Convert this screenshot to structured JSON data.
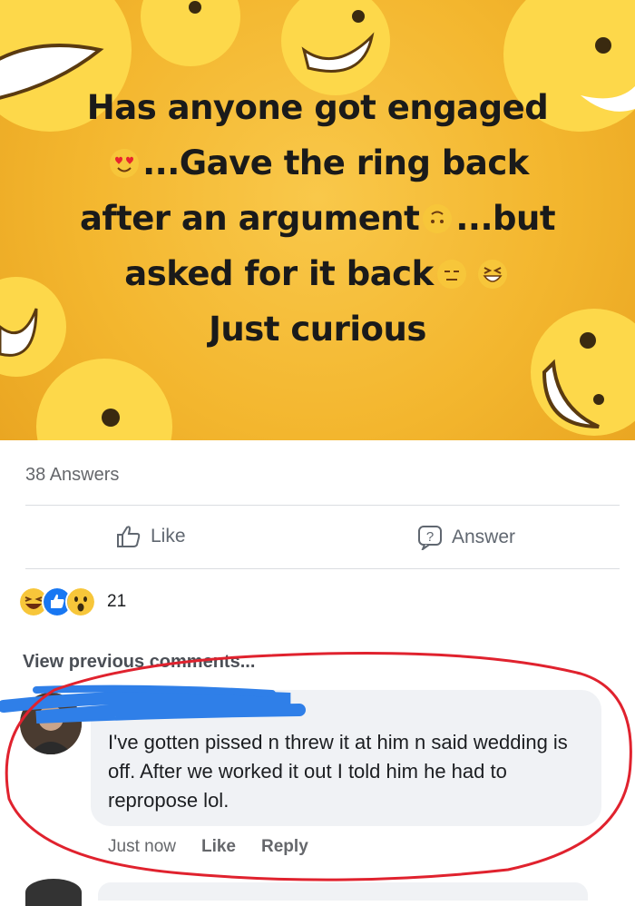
{
  "post": {
    "headline_lines": [
      "Has anyone got engaged",
      "...Gave the ring back",
      "after an argument",
      "...but",
      "asked for it back",
      "Just curious"
    ],
    "answers_count": "38 Answers",
    "like_label": "Like",
    "answer_label": "Answer",
    "reaction_count": "21",
    "reaction_icons": [
      "laughing-reaction-icon",
      "like-reaction-icon",
      "wow-reaction-icon"
    ]
  },
  "comments": {
    "view_previous": "View previous comments...",
    "comment_text": "I've gotten pissed n threw it at him n said wedding is off. After we worked it out I told him he had to repropose lol.",
    "timestamp": "Just now",
    "like_label": "Like",
    "reply_label": "Reply"
  },
  "colors": {
    "banner": "#f3b62e",
    "annotation_circle": "#e0222e",
    "redaction": "#2f7fe8",
    "bubble": "#f0f2f5"
  }
}
